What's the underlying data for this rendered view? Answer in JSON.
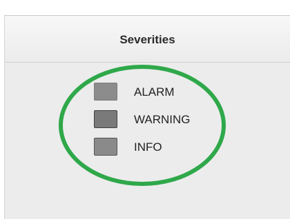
{
  "panel": {
    "title": "Severities"
  },
  "legend": {
    "items": [
      {
        "label": "ALARM",
        "swatch_color": "#8c8c8c",
        "swatch_border": "#7a7a7a"
      },
      {
        "label": "WARNING",
        "swatch_color": "#7a7a7a",
        "swatch_border": "#3f3f3f"
      },
      {
        "label": "INFO",
        "swatch_color": "#8a8a8a",
        "swatch_border": "#555555"
      }
    ]
  },
  "annotation": {
    "shape": "ellipse",
    "color": "#2fa84a"
  }
}
